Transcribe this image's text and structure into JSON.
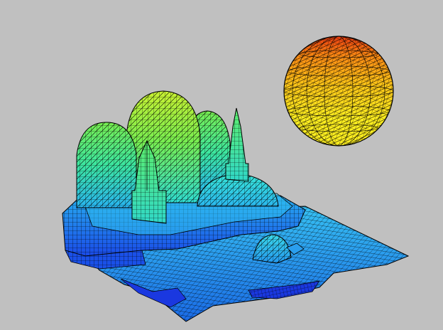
{
  "scene": {
    "background_color": "#c0c0c0",
    "wireframe_color": "#000000",
    "colormap": [
      "#1432e6",
      "#1e78f0",
      "#28b4f0",
      "#30dcd0",
      "#3ce6a0",
      "#78ee50",
      "#c8f032",
      "#fff020",
      "#ffc818",
      "#ff8c14",
      "#e83c10"
    ],
    "objects": [
      "mesh-ground-plane",
      "castle-base",
      "large-dome",
      "left-dome",
      "right-dome",
      "small-dome",
      "left-spire",
      "right-spire",
      "small-mound",
      "sphere"
    ]
  }
}
